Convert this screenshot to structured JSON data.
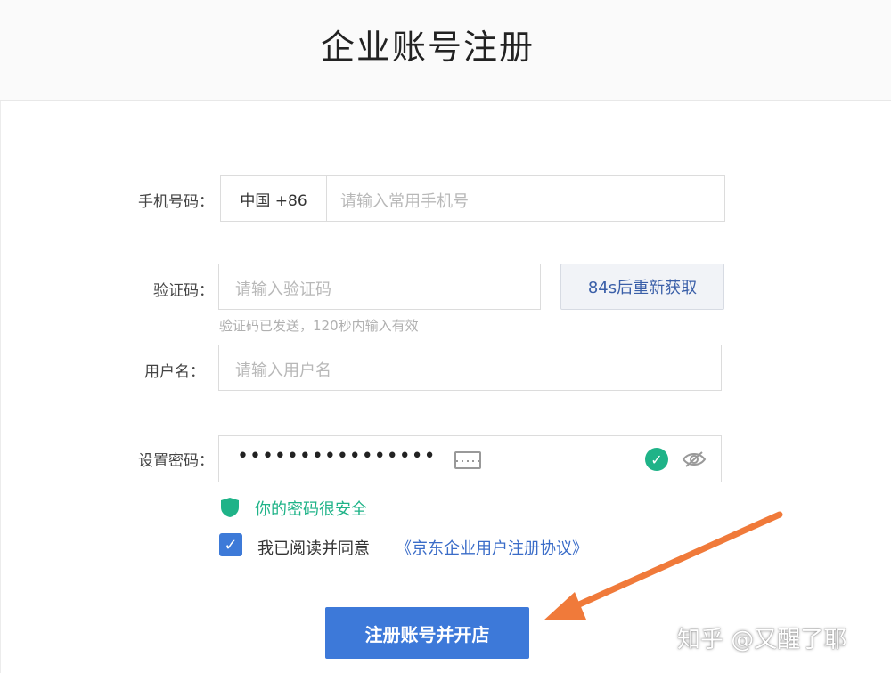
{
  "header": {
    "title": "企业账号注册"
  },
  "form": {
    "phone": {
      "label": "手机号码：",
      "country": "中国  +86",
      "placeholder": "请输入常用手机号"
    },
    "code": {
      "label": "验证码：",
      "placeholder": "请输入验证码",
      "resend_button": "84s后重新获取",
      "hint": "验证码已发送，120秒内输入有效"
    },
    "username": {
      "label": "用户名：",
      "placeholder": "请输入用户名"
    },
    "password": {
      "label": "设置密码：",
      "value": "••••••••••••••••"
    },
    "strength": {
      "text": "你的密码很安全"
    },
    "agreement": {
      "text": "我已阅读并同意",
      "link": "《京东企业用户注册协议》",
      "checked": true
    },
    "submit_label": "注册账号并开店"
  },
  "watermark": "知乎 @又醒了耶",
  "colors": {
    "primary": "#3d79d9",
    "success": "#1fb388",
    "annotation_arrow": "#f07a3a"
  },
  "icons": [
    "keyboard-icon",
    "check-circle-icon",
    "eye-hidden-icon",
    "shield-icon",
    "checkbox-checked-icon",
    "arrow-annotation"
  ]
}
